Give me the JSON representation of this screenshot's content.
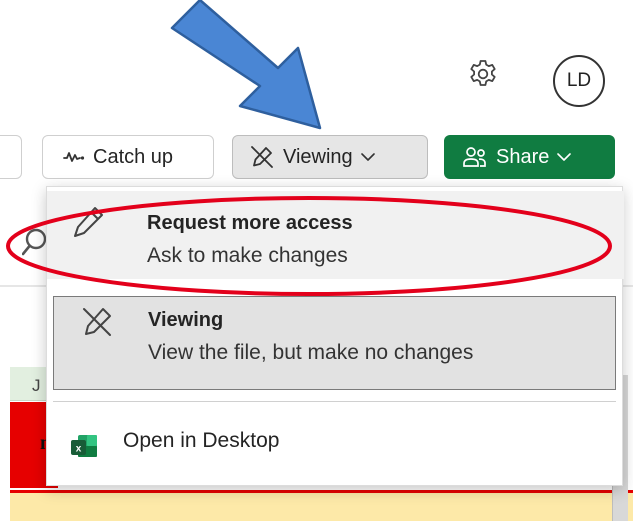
{
  "header": {
    "avatar_initials": "LD",
    "settings_icon": "gear-icon"
  },
  "toolbar": {
    "catchup": {
      "label": "Catch up",
      "icon": "activity-icon"
    },
    "viewing": {
      "label": "Viewing",
      "icon": "pen-off-icon"
    },
    "share": {
      "label": "Share",
      "icon": "people-icon"
    }
  },
  "menu": {
    "items": [
      {
        "title": "Request more access",
        "subtitle": "Ask to make changes",
        "icon": "pen-icon"
      },
      {
        "title": "Viewing",
        "subtitle": "View the file, but make no changes",
        "icon": "pen-off-icon",
        "selected": true
      }
    ],
    "open_desktop": {
      "label": "Open in Desktop",
      "icon": "excel-icon"
    }
  },
  "sheet": {
    "column_letter": "J",
    "cell_fragment": "nti"
  },
  "colors": {
    "share_green": "#107c41",
    "annotation_red": "#e3001b",
    "annotation_arrow_blue": "#4a86d4",
    "sheet_red": "#e60000",
    "sheet_yellow": "#fde9a8"
  }
}
